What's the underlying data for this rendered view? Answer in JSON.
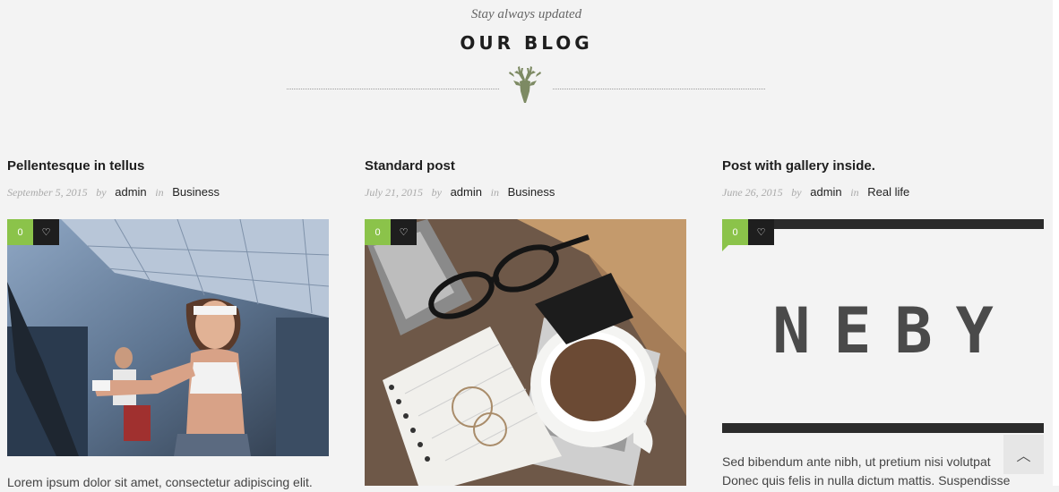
{
  "section": {
    "subtitle": "Stay always updated",
    "title": "OUR BLOG",
    "emblem_icon": "deer-head-icon"
  },
  "posts": [
    {
      "title": "Pellentesque in tellus",
      "date": "September 5, 2015",
      "by_word": "by",
      "author": "admin",
      "in_word": "in",
      "category": "Business",
      "likes": "0",
      "heart_icon": "heart-icon",
      "image": "fitness-gym-photo",
      "excerpt": "Lorem ipsum dolor sit amet, consectetur adipiscing elit."
    },
    {
      "title": "Standard post",
      "date": "July 21, 2015",
      "by_word": "by",
      "author": "admin",
      "in_word": "in",
      "category": "Business",
      "likes": "0",
      "heart_icon": "heart-icon",
      "image": "desk-coffee-notebook-photo"
    },
    {
      "title": "Post with gallery inside.",
      "date": "June 26, 2015",
      "by_word": "by",
      "author": "admin",
      "in_word": "in",
      "category": "Real life",
      "likes": "0",
      "heart_icon": "heart-icon",
      "gallery_text": "NEBY",
      "excerpt_lines": [
        "Sed bibendum ante nibh, ut pretium nisi volutpat",
        "Donec quis felis in nulla dictum mattis. Suspendisse"
      ]
    }
  ],
  "scroll_top_icon": "chevron-up-icon",
  "colors": {
    "accent_green": "#8bc34a",
    "dark": "#1e1e1e",
    "background": "#f3f3f3",
    "emblem": "#7d8a63"
  }
}
